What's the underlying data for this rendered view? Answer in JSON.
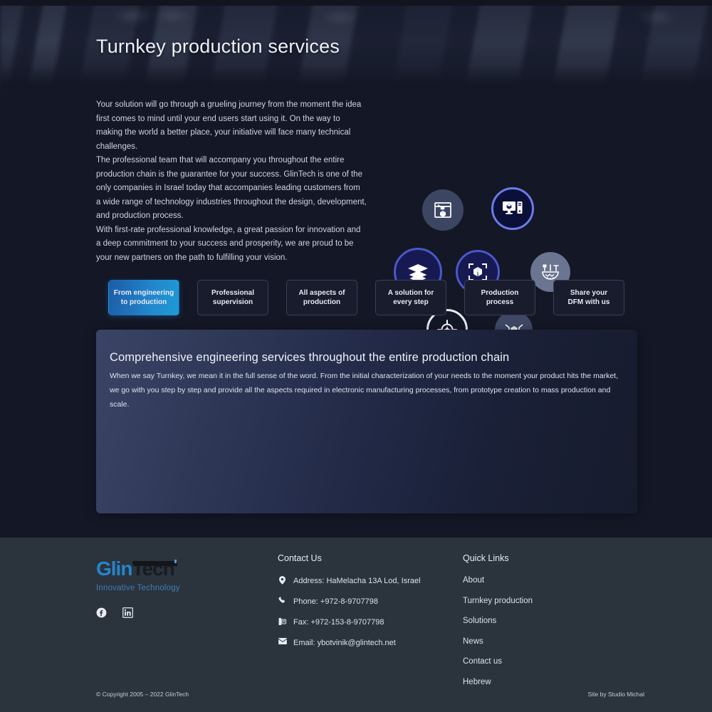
{
  "colors": {
    "page_bg": "#141725",
    "footer_bg": "#2b333d",
    "accent_blue": "#1e9ad6",
    "accent_blue_dark": "#1d5ba6",
    "ring_purple": "#6a7ce8",
    "logo_blue": "#2585c9",
    "panel_from": "#3b4466",
    "panel_to": "#171b2d"
  },
  "hero": {
    "title": "Turnkey production services",
    "background_icon": "factory-machinery-photo"
  },
  "intro": {
    "paragraphs": [
      "Your solution will go through a grueling journey from the moment the idea first comes to mind until your end users start using it. On the way to making the world a better place, your initiative will face many technical challenges.",
      "The professional team that will accompany you throughout the entire production chain is the guarantee for your success. GlinTech is one of the only companies in Israel today that accompanies leading customers from a wide range of technology industries throughout the design, development, and production process.",
      "With first-rate professional knowledge, a great passion for innovation and a deep commitment to your success and prosperity, we are proud to be your new partners on the path to fulfilling your vision."
    ]
  },
  "icon_cluster": {
    "icons": [
      {
        "name": "3d-printer-icon",
        "style": "grey"
      },
      {
        "name": "cad-workstation-icon",
        "style": "ringed"
      },
      {
        "name": "layers-stack-icon",
        "style": "solid-ring"
      },
      {
        "name": "3d-model-scan-icon",
        "style": "solid-ring"
      },
      {
        "name": "tooling-fixture-icon",
        "style": "slate"
      },
      {
        "name": "precision-target-icon",
        "style": "outline"
      },
      {
        "name": "product-assembly-icon",
        "style": "dim"
      }
    ]
  },
  "tabs": [
    {
      "label": "From engineering to production",
      "line1": "From engineering",
      "line2": "to production",
      "active": true
    },
    {
      "label": "Professional supervision",
      "line1": "Professional",
      "line2": "supervision",
      "active": false
    },
    {
      "label": "All aspects of production",
      "line1": "All aspects of",
      "line2": "production",
      "active": false
    },
    {
      "label": "A solution for every step",
      "line1": "A solution for",
      "line2": "every step",
      "active": false
    },
    {
      "label": "Production process",
      "line1": "Production",
      "line2": "process",
      "active": false
    },
    {
      "label": "Share your DFM with us",
      "line1": "Share your",
      "line2": "DFM with us",
      "active": false
    }
  ],
  "panel": {
    "title": "Comprehensive engineering services throughout the entire production chain",
    "body": "When we say Turnkey, we mean it in the full sense of the word. From the initial characterization of your needs to the moment your product hits the market, we go with you step by step and provide all the aspects required in electronic manufacturing processes, from prototype creation to mass production and scale."
  },
  "footer": {
    "logo": {
      "part1": "Glin",
      "part2": "Tech",
      "tagline": "Innovative Technology"
    },
    "socials": [
      {
        "name": "facebook-icon",
        "label": "Facebook"
      },
      {
        "name": "linkedin-icon",
        "label": "LinkedIn"
      }
    ],
    "contact": {
      "heading": "Contact Us",
      "rows": [
        {
          "icon": "location-pin-icon",
          "text": "Address: HaMelacha 13A Lod, Israel"
        },
        {
          "icon": "phone-icon",
          "text": "Phone: +972-8-9707798"
        },
        {
          "icon": "fax-icon",
          "text": "Fax: +972-153-8-9707798"
        },
        {
          "icon": "envelope-icon",
          "text": "Email: ybotvinik@glintech.net"
        }
      ]
    },
    "quick_links": {
      "heading": "Quick Links",
      "items": [
        {
          "label": "About"
        },
        {
          "label": "Turnkey production"
        },
        {
          "label": "Solutions"
        },
        {
          "label": "News"
        },
        {
          "label": "Contact us"
        },
        {
          "label": "Hebrew"
        }
      ]
    },
    "copyright": "© Copyright 2005 – 2022 GlinTech",
    "credit": "Site by Studio Michal"
  }
}
